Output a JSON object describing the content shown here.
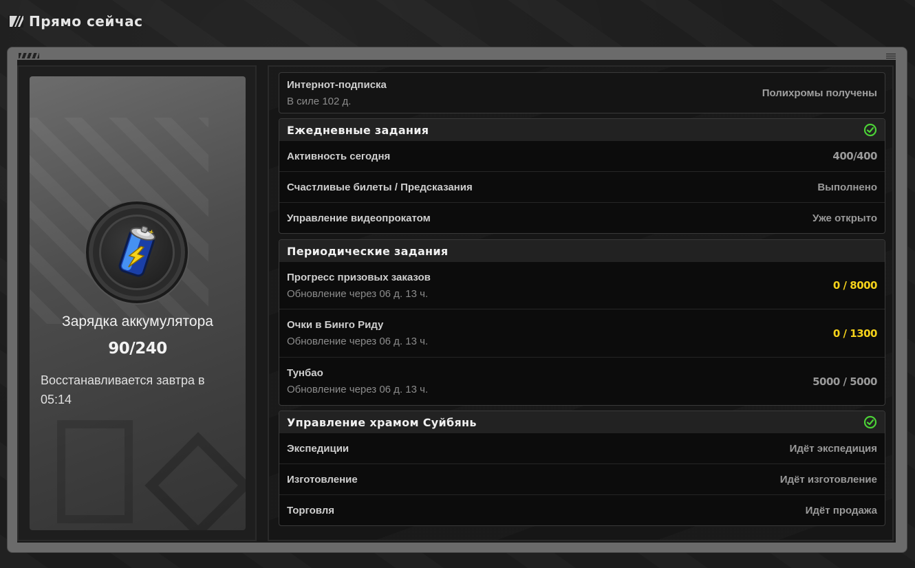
{
  "header": {
    "title": "Прямо сейчас"
  },
  "battery": {
    "label": "Зарядка аккумулятора",
    "value": "90/240",
    "restore_text": "Восстанавливается завтра в 05:14"
  },
  "subscription": {
    "label": "Интернот-подписка",
    "sub": "В силе 102 д.",
    "status": "Полихромы получены"
  },
  "daily": {
    "title": "Ежедневные задания",
    "completed": true,
    "rows": [
      {
        "label": "Активность сегодня",
        "value": "400/400"
      },
      {
        "label": "Счастливые билеты / Предсказания",
        "value": "Выполнено"
      },
      {
        "label": "Управление видеопрокатом",
        "value": "Уже открыто"
      }
    ]
  },
  "periodic": {
    "title": "Периодические задания",
    "rows": [
      {
        "label": "Прогресс призовых заказов",
        "sub": "Обновление через 06 д. 13 ч.",
        "value": "0 / 8000"
      },
      {
        "label": "Очки в Бинго Риду",
        "sub": "Обновление через 06 д. 13 ч.",
        "value": "0 / 1300"
      },
      {
        "label": "Тунбао",
        "sub": "Обновление через 06 д. 13 ч.",
        "value": "5000 / 5000"
      }
    ]
  },
  "temple": {
    "title": "Управление храмом Суйбянь",
    "completed": true,
    "rows": [
      {
        "label": "Экспедиции",
        "value": "Идёт экспедиция"
      },
      {
        "label": "Изготовление",
        "value": "Идёт изготовление"
      },
      {
        "label": "Торговля",
        "value": "Идёт продажа"
      }
    ]
  },
  "colors": {
    "accent_yellow": "#f5d21a",
    "check_green": "#4cd137"
  },
  "icons": {
    "logo": "zzz-logo-icon",
    "battery": "battery-icon",
    "check": "check-circle-icon"
  }
}
